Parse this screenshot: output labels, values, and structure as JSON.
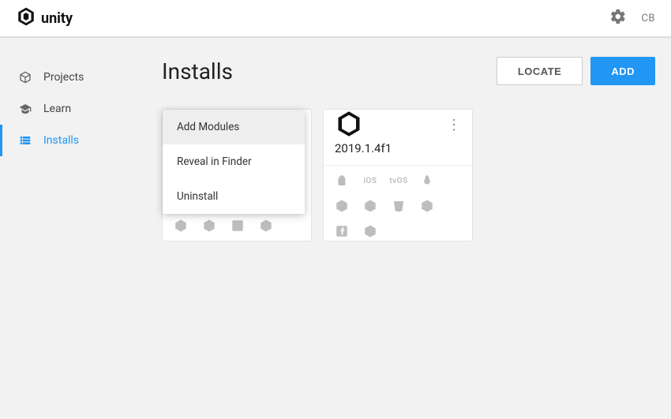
{
  "brand": {
    "name": "unity"
  },
  "user": {
    "initials": "CB"
  },
  "sidebar": {
    "items": [
      {
        "label": "Projects"
      },
      {
        "label": "Learn"
      },
      {
        "label": "Installs"
      }
    ]
  },
  "page": {
    "title": "Installs"
  },
  "buttons": {
    "locate": "LOCATE",
    "add": "ADD"
  },
  "installs": [
    {
      "version": "2019.1.4f1"
    }
  ],
  "context_menu": {
    "items": [
      {
        "label": "Add Modules"
      },
      {
        "label": "Reveal in Finder"
      },
      {
        "label": "Uninstall"
      }
    ]
  },
  "platform_labels": {
    "ios": "iOS",
    "tvos": "tvOS"
  }
}
